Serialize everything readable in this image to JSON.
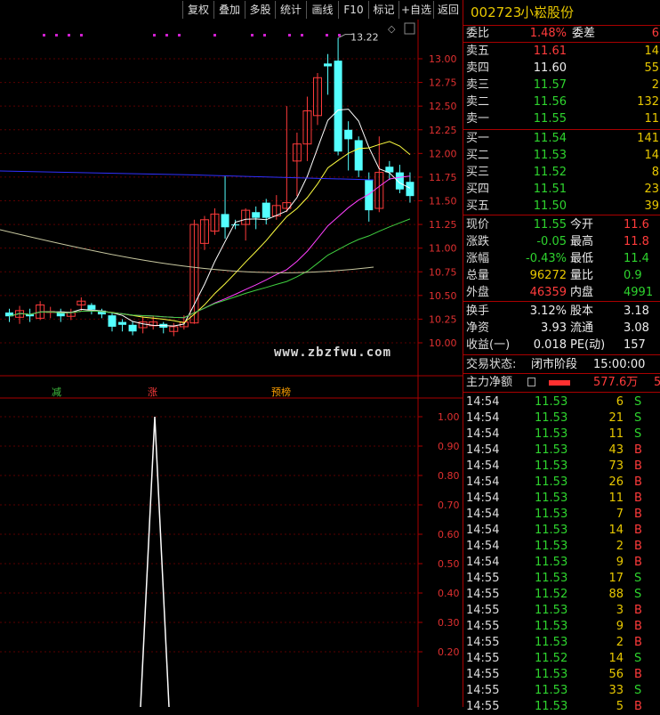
{
  "toolbar": {
    "items": [
      "复权",
      "叠加",
      "多股",
      "统计",
      "画线",
      "F10",
      "标记",
      "+自选",
      "返回"
    ]
  },
  "chart": {
    "price_axis": [
      "13.00",
      "12.75",
      "12.50",
      "12.25",
      "12.00",
      "11.75",
      "11.50",
      "11.25",
      "11.00",
      "10.75",
      "10.50",
      "10.25",
      "10.00"
    ],
    "high_label": "13.22",
    "markers": [
      "减",
      "涨",
      "预榜"
    ],
    "lower_axis": [
      "1.00",
      "0.90",
      "0.80",
      "0.70",
      "0.60",
      "0.50",
      "0.40",
      "0.30",
      "0.20"
    ],
    "watermark": "www.zbzfwu.com"
  },
  "chart_data": [
    {
      "type": "candlestick",
      "y_axis_range": [
        10.0,
        13.0
      ],
      "candles": [
        {
          "o": 10.32,
          "c": 10.28,
          "h": 10.36,
          "l": 10.22
        },
        {
          "o": 10.27,
          "c": 10.34,
          "h": 10.39,
          "l": 10.2
        },
        {
          "o": 10.3,
          "c": 10.28,
          "h": 10.36,
          "l": 10.22
        },
        {
          "o": 10.26,
          "c": 10.4,
          "h": 10.44,
          "l": 10.24
        },
        {
          "o": 10.33,
          "c": 10.33,
          "h": 10.38,
          "l": 10.26
        },
        {
          "o": 10.33,
          "c": 10.28,
          "h": 10.36,
          "l": 10.22
        },
        {
          "o": 10.28,
          "c": 10.32,
          "h": 10.36,
          "l": 10.24
        },
        {
          "o": 10.4,
          "c": 10.44,
          "h": 10.48,
          "l": 10.34
        },
        {
          "o": 10.4,
          "c": 10.35,
          "h": 10.42,
          "l": 10.3
        },
        {
          "o": 10.34,
          "c": 10.3,
          "h": 10.36,
          "l": 10.26
        },
        {
          "o": 10.29,
          "c": 10.17,
          "h": 10.31,
          "l": 10.12
        },
        {
          "o": 10.22,
          "c": 10.19,
          "h": 10.25,
          "l": 10.12
        },
        {
          "o": 10.19,
          "c": 10.12,
          "h": 10.23,
          "l": 10.08
        },
        {
          "o": 10.16,
          "c": 10.22,
          "h": 10.28,
          "l": 10.1
        },
        {
          "o": 10.18,
          "c": 10.22,
          "h": 10.28,
          "l": 10.14
        },
        {
          "o": 10.2,
          "c": 10.16,
          "h": 10.22,
          "l": 10.1
        },
        {
          "o": 10.12,
          "c": 10.17,
          "h": 10.21,
          "l": 10.07
        },
        {
          "o": 10.17,
          "c": 10.22,
          "h": 10.29,
          "l": 10.14
        },
        {
          "o": 10.21,
          "c": 11.25,
          "h": 11.3,
          "l": 10.2
        },
        {
          "o": 11.05,
          "c": 11.3,
          "h": 11.34,
          "l": 10.98
        },
        {
          "o": 11.18,
          "c": 11.36,
          "h": 11.42,
          "l": 11.14
        },
        {
          "o": 11.36,
          "c": 11.22,
          "h": 11.76,
          "l": 11.1
        },
        {
          "o": 11.25,
          "c": 11.24,
          "h": 11.3,
          "l": 11.2
        },
        {
          "o": 11.25,
          "c": 11.4,
          "h": 11.42,
          "l": 11.08
        },
        {
          "o": 11.38,
          "c": 11.32,
          "h": 11.44,
          "l": 11.2
        },
        {
          "o": 11.48,
          "c": 11.32,
          "h": 11.52,
          "l": 11.25
        },
        {
          "o": 11.34,
          "c": 11.45,
          "h": 11.56,
          "l": 11.3
        },
        {
          "o": 11.42,
          "c": 11.48,
          "h": 12.5,
          "l": 11.38
        },
        {
          "o": 11.92,
          "c": 12.1,
          "h": 12.22,
          "l": 11.55
        },
        {
          "o": 12.1,
          "c": 12.45,
          "h": 12.6,
          "l": 11.92
        },
        {
          "o": 12.4,
          "c": 12.8,
          "h": 12.85,
          "l": 12.3
        },
        {
          "o": 12.95,
          "c": 12.92,
          "h": 13.05,
          "l": 12.62
        },
        {
          "o": 12.98,
          "c": 12.02,
          "h": 13.22,
          "l": 11.98
        },
        {
          "o": 12.25,
          "c": 12.15,
          "h": 12.34,
          "l": 11.82
        },
        {
          "o": 12.14,
          "c": 11.82,
          "h": 12.18,
          "l": 11.75
        },
        {
          "o": 11.72,
          "c": 11.4,
          "h": 11.8,
          "l": 11.28
        },
        {
          "o": 11.42,
          "c": 11.8,
          "h": 12.18,
          "l": 11.38
        },
        {
          "o": 11.86,
          "c": 11.8,
          "h": 11.92,
          "l": 11.72
        },
        {
          "o": 11.8,
          "c": 11.62,
          "h": 11.88,
          "l": 11.58
        },
        {
          "o": 11.7,
          "c": 11.55,
          "h": 11.8,
          "l": 11.48
        }
      ]
    },
    {
      "type": "line",
      "name": "lower-indicator",
      "y_axis_range": [
        0,
        1
      ],
      "peak": 1.0
    }
  ],
  "stock": {
    "code": "002723",
    "name": "小崧股份"
  },
  "orderbook": {
    "weibi_label": "委比",
    "weibi": "1.48%",
    "weicha_label": "委差",
    "weicha": "6",
    "asks": [
      {
        "label": "卖五",
        "price": "11.61",
        "vol": "14"
      },
      {
        "label": "卖四",
        "price": "11.60",
        "vol": "55"
      },
      {
        "label": "卖三",
        "price": "11.57",
        "vol": "2"
      },
      {
        "label": "卖二",
        "price": "11.56",
        "vol": "132"
      },
      {
        "label": "卖一",
        "price": "11.55",
        "vol": "11"
      }
    ],
    "bids": [
      {
        "label": "买一",
        "price": "11.54",
        "vol": "141"
      },
      {
        "label": "买二",
        "price": "11.53",
        "vol": "14"
      },
      {
        "label": "买三",
        "price": "11.52",
        "vol": "8"
      },
      {
        "label": "买四",
        "price": "11.51",
        "vol": "23"
      },
      {
        "label": "买五",
        "price": "11.50",
        "vol": "39"
      }
    ]
  },
  "quote": [
    {
      "l1": "现价",
      "v1": "11.55",
      "l2": "今开",
      "v2": "11.6"
    },
    {
      "l1": "涨跌",
      "v1": "-0.05",
      "l2": "最高",
      "v2": "11.8"
    },
    {
      "l1": "涨幅",
      "v1": "-0.43%",
      "l2": "最低",
      "v2": "11.4"
    },
    {
      "l1": "总量",
      "v1": "96272",
      "l2": "量比",
      "v2": "0.9"
    },
    {
      "l1": "外盘",
      "v1": "46359",
      "l2": "内盘",
      "v2": "4991"
    },
    {
      "l1": "换手",
      "v1": "3.12%",
      "l2": "股本",
      "v2": "3.18"
    },
    {
      "l1": "净资",
      "v1": "3.93",
      "l2": "流通",
      "v2": "3.08"
    },
    {
      "l1": "收益(一)",
      "v1": "0.018",
      "l2": "PE(动)",
      "v2": "157"
    }
  ],
  "status": {
    "label": "交易状态:",
    "value": "闭市阶段",
    "time": "15:00:00"
  },
  "mainflow": {
    "label": "主力净额",
    "value": "577.6万",
    "extra": "5"
  },
  "ticks": [
    {
      "t": "14:54",
      "p": "11.53",
      "q": "6",
      "s": "S"
    },
    {
      "t": "14:54",
      "p": "11.53",
      "q": "21",
      "s": "S"
    },
    {
      "t": "14:54",
      "p": "11.53",
      "q": "11",
      "s": "S"
    },
    {
      "t": "14:54",
      "p": "11.53",
      "q": "43",
      "s": "B"
    },
    {
      "t": "14:54",
      "p": "11.53",
      "q": "73",
      "s": "B"
    },
    {
      "t": "14:54",
      "p": "11.53",
      "q": "26",
      "s": "B"
    },
    {
      "t": "14:54",
      "p": "11.53",
      "q": "11",
      "s": "B"
    },
    {
      "t": "14:54",
      "p": "11.53",
      "q": "7",
      "s": "B"
    },
    {
      "t": "14:54",
      "p": "11.53",
      "q": "14",
      "s": "B"
    },
    {
      "t": "14:54",
      "p": "11.53",
      "q": "2",
      "s": "B"
    },
    {
      "t": "14:54",
      "p": "11.53",
      "q": "9",
      "s": "B"
    },
    {
      "t": "14:55",
      "p": "11.53",
      "q": "17",
      "s": "S"
    },
    {
      "t": "14:55",
      "p": "11.52",
      "q": "88",
      "s": "S"
    },
    {
      "t": "14:55",
      "p": "11.53",
      "q": "3",
      "s": "B"
    },
    {
      "t": "14:55",
      "p": "11.53",
      "q": "9",
      "s": "B"
    },
    {
      "t": "14:55",
      "p": "11.53",
      "q": "2",
      "s": "B"
    },
    {
      "t": "14:55",
      "p": "11.52",
      "q": "14",
      "s": "S"
    },
    {
      "t": "14:55",
      "p": "11.53",
      "q": "56",
      "s": "B"
    },
    {
      "t": "14:55",
      "p": "11.53",
      "q": "33",
      "s": "S"
    },
    {
      "t": "14:55",
      "p": "11.53",
      "q": "5",
      "s": "B"
    }
  ]
}
